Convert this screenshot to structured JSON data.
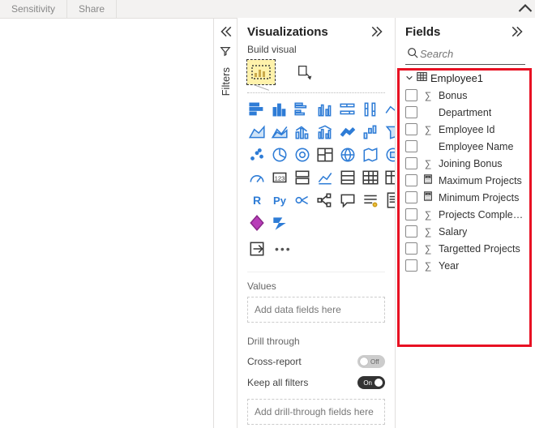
{
  "ribbon": {
    "sensitivity": "Sensitivity",
    "share": "Share"
  },
  "filters": {
    "label": "Filters"
  },
  "viz": {
    "title": "Visualizations",
    "build_label": "Build visual",
    "values_label": "Values",
    "values_placeholder": "Add data fields here",
    "drill_label": "Drill through",
    "cross_report_label": "Cross-report",
    "cross_report_state": "Off",
    "keep_filters_label": "Keep all filters",
    "keep_filters_state": "On",
    "drill_placeholder": "Add drill-through fields here",
    "r_label": "R",
    "py_label": "Py"
  },
  "fields": {
    "title": "Fields",
    "search_placeholder": "Search",
    "table": "Employee1",
    "items": [
      {
        "label": "Bonus",
        "type": "sum"
      },
      {
        "label": "Department",
        "type": "text"
      },
      {
        "label": "Employee Id",
        "type": "sum"
      },
      {
        "label": "Employee Name",
        "type": "text"
      },
      {
        "label": "Joining Bonus",
        "type": "sum"
      },
      {
        "label": "Maximum Projects",
        "type": "calc"
      },
      {
        "label": "Minimum Projects",
        "type": "calc"
      },
      {
        "label": "Projects Complet…",
        "type": "sum"
      },
      {
        "label": "Salary",
        "type": "sum"
      },
      {
        "label": "Targetted Projects",
        "type": "sum"
      },
      {
        "label": "Year",
        "type": "sum"
      }
    ]
  }
}
